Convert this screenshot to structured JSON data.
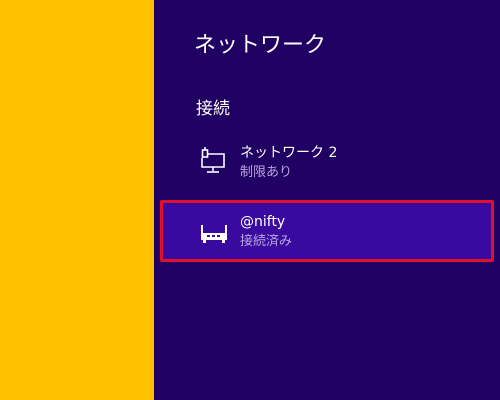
{
  "pane": {
    "title": "ネットワーク",
    "section_header": "接続"
  },
  "networks": [
    {
      "name": "ネットワーク 2",
      "status": "制限あり",
      "icon": "wired-network-icon"
    },
    {
      "name": "@nifty",
      "status": "接続済み",
      "icon": "broadband-router-icon"
    }
  ],
  "colors": {
    "desktop_background": "#ffc000",
    "pane_background": "#200063",
    "selected_background": "#3a0aa0",
    "highlight_border": "#e0102a",
    "secondary_text": "#b9a7de"
  }
}
